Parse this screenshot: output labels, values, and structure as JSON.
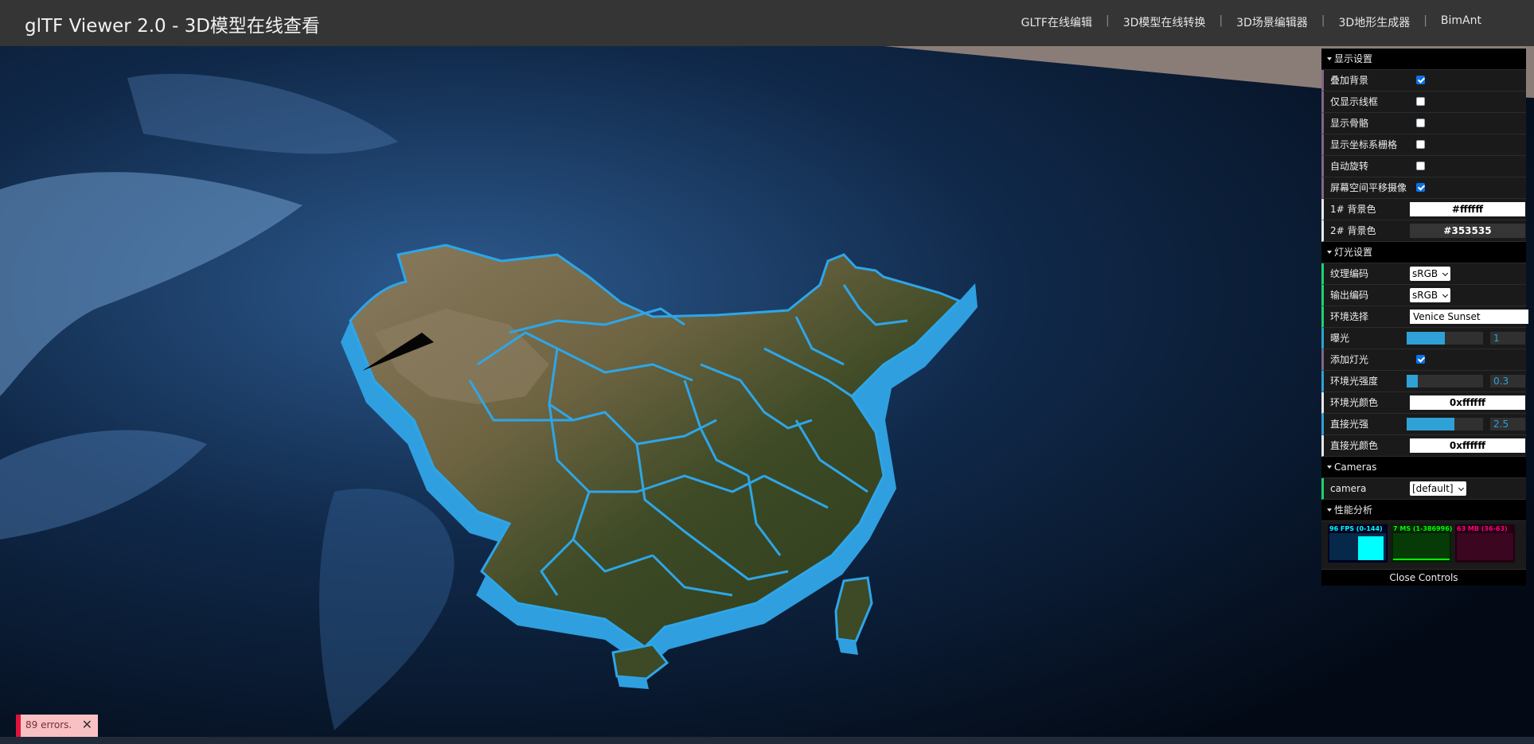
{
  "header": {
    "title": "glTF Viewer 2.0 - 3D模型在线查看",
    "nav": [
      {
        "label": "GLTF在线编辑"
      },
      {
        "label": "3D模型在线转换"
      },
      {
        "label": "3D场景编辑器"
      },
      {
        "label": "3D地形生成器"
      },
      {
        "label": "BimAnt"
      }
    ]
  },
  "gui": {
    "display": {
      "title": "显示设置",
      "background": {
        "label": "叠加背景",
        "checked": true
      },
      "wireframe": {
        "label": "仅显示线框",
        "checked": false
      },
      "skeleton": {
        "label": "显示骨骼",
        "checked": false
      },
      "grid": {
        "label": "显示坐标系栅格",
        "checked": false
      },
      "autorotate": {
        "label": "自动旋转",
        "checked": false
      },
      "screenspace_pan": {
        "label": "屏幕空间平移摄像",
        "checked": true
      },
      "bg1": {
        "label": "1# 背景色",
        "value": "#ffffff"
      },
      "bg2": {
        "label": "2# 背景色",
        "value": "#353535"
      }
    },
    "lighting": {
      "title": "灯光设置",
      "texture_encoding": {
        "label": "纹理编码",
        "value": "sRGB"
      },
      "output_encoding": {
        "label": "输出编码",
        "value": "sRGB"
      },
      "environment": {
        "label": "环境选择",
        "value": "Venice Sunset"
      },
      "exposure": {
        "label": "曝光",
        "value": "1",
        "fraction": 0.5
      },
      "add_lights": {
        "label": "添加灯光",
        "checked": true
      },
      "ambient_intensity": {
        "label": "环境光强度",
        "value": "0.3",
        "fraction": 0.15
      },
      "ambient_color": {
        "label": "环境光颜色",
        "value": "0xffffff"
      },
      "direct_intensity": {
        "label": "直接光强",
        "value": "2.5",
        "fraction": 0.62
      },
      "direct_color": {
        "label": "直接光颜色",
        "value": "0xffffff"
      }
    },
    "cameras": {
      "title": "Cameras",
      "camera": {
        "label": "camera",
        "value": "[default]"
      }
    },
    "performance": {
      "title": "性能分析",
      "fps": "96 FPS (0-144)",
      "ms": "7 MS (1-386996)",
      "mb": "63 MB (36-63)"
    },
    "close_label": "Close Controls"
  },
  "errors": {
    "text": "89 errors."
  },
  "colors": {
    "header_bg": "#353535",
    "gui_bg": "#1a1a1a",
    "accent_blue": "#2fa1d6",
    "province_border": "#2ea6e8",
    "fps": "#00ffff",
    "ms": "#00ff00",
    "mb": "#ff0080"
  }
}
